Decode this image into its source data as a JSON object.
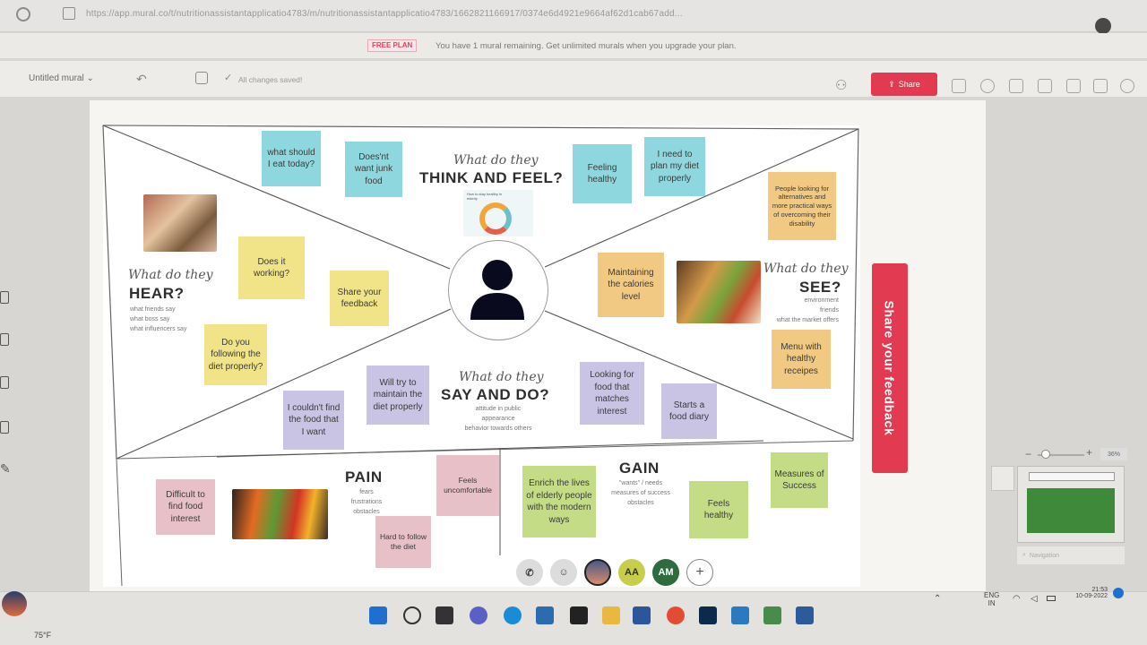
{
  "browser": {
    "url": "https://app.mural.co/t/nutritionassistantapplicatio4783/m/nutritionassistantapplicatio4783/1662821166917/0374e6d4921e9664af62d1cab67add..."
  },
  "banner": {
    "plan_badge": "FREE PLAN",
    "message": "You have 1 mural remaining. Get unlimited murals when you upgrade your plan."
  },
  "toolbar": {
    "mural_title": "Untitled mural",
    "save_status": "All changes saved!",
    "share_label": "Share"
  },
  "board": {
    "think_feel": {
      "script": "What do they",
      "heading": "THINK AND FEEL?"
    },
    "hear": {
      "script": "What do they",
      "heading": "HEAR?",
      "hints": [
        "what friends say",
        "what boss say",
        "what influencers say"
      ]
    },
    "see": {
      "script": "What do they",
      "heading": "SEE?",
      "hints": [
        "environment",
        "friends",
        "what the market offers"
      ]
    },
    "say_do": {
      "script": "What do they",
      "heading": "SAY AND DO?",
      "hints": [
        "attitude in public",
        "appearance",
        "behavior towards others"
      ]
    },
    "pain": {
      "heading": "PAIN",
      "hints": [
        "fears",
        "frustrations",
        "obstacles"
      ]
    },
    "gain": {
      "heading": "GAIN",
      "hints": [
        "\"wants\" / needs",
        "measures of success",
        "obstacles"
      ]
    },
    "stickies": {
      "what_eat": "what should I eat today?",
      "junk": "Does'nt want junk food",
      "feeling_healthy": "Feeling healthy",
      "plan_diet": "I need to plan my diet properly",
      "alternatives": "People looking for alternatives and more practical ways of overcoming their disability",
      "does_it_work": "Does it working?",
      "share_feedback": "Share your feedback",
      "following_diet": "Do you following the diet properly?",
      "maintain_cal": "Maintaining the calories level",
      "menu": "Menu with healthy receipes",
      "couldnt_find": "I couldn't find the food that I want",
      "maintain_diet": "Will try to maintain the diet properly",
      "looking_food": "Looking for food that matches interest",
      "food_diary": "Starts a food diary",
      "difficult": "Difficult to find food interest",
      "uncomfortable": "Feels uncomfortable",
      "hard_follow": "Hard to follow the diet",
      "enrich": "Enrich the lives of elderly people with the modern ways",
      "feels_healthy": "Feels healthy",
      "measures": "Measures of Success"
    },
    "infographic_text": "How to stay healthy in elderly"
  },
  "feedback": {
    "label": "Share your feedback"
  },
  "zoom": {
    "value": "36%"
  },
  "collaborators": [
    "AA",
    "AM"
  ],
  "minimap": {
    "label": "Navigation"
  },
  "taskbar": {
    "weather": "75°F",
    "lang_top": "ENG",
    "lang_bottom": "IN",
    "time": "21:53",
    "date": "10-09-2022"
  },
  "colors": {
    "accent": "#e23a50",
    "teal": "#8fd7df",
    "yellow": "#f1e387",
    "orange": "#f2c983",
    "purple": "#c9c3e4",
    "pink": "#e7c0c8",
    "green": "#c5dc86"
  }
}
